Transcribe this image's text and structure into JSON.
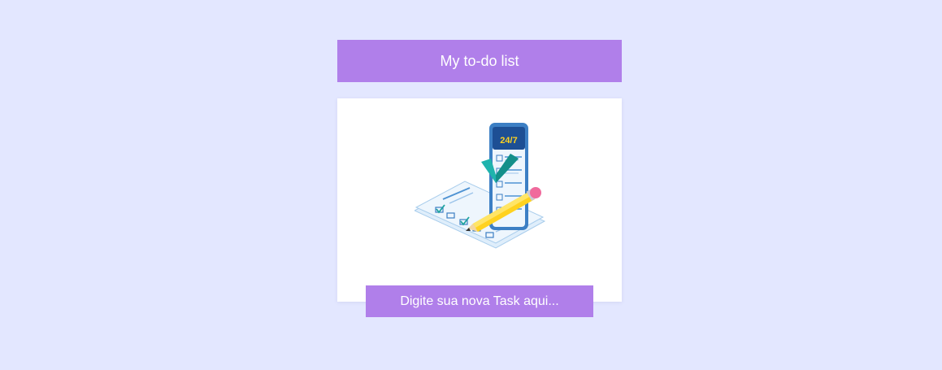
{
  "header": {
    "title": "My to-do list"
  },
  "illustration": {
    "icon": "todo-checklist-phone-illustration",
    "phone_badge": "24/7"
  },
  "task_input": {
    "placeholder": "Digite sua nova Task aqui...",
    "value": ""
  },
  "colors": {
    "background": "#e3e7ff",
    "accent": "#b07fea",
    "card": "#ffffff"
  }
}
